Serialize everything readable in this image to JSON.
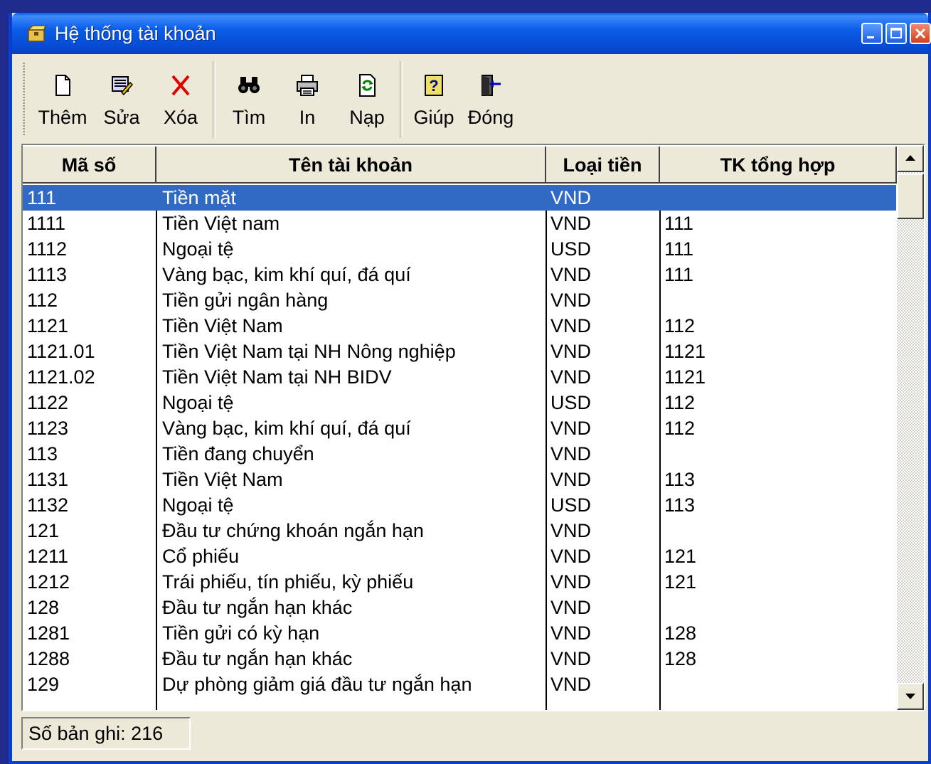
{
  "window": {
    "title": "Hệ thống tài khoản",
    "title_icon": "folder-box-icon"
  },
  "toolbar": {
    "buttons": [
      {
        "label": "Thêm",
        "icon": "new-document-icon"
      },
      {
        "label": "Sửa",
        "icon": "edit-icon"
      },
      {
        "label": "Xóa",
        "icon": "delete-x-icon"
      },
      {
        "label": "Tìm",
        "icon": "binoculars-icon"
      },
      {
        "label": "In",
        "icon": "printer-icon"
      },
      {
        "label": "Nạp",
        "icon": "refresh-icon"
      },
      {
        "label": "Giúp",
        "icon": "help-icon"
      },
      {
        "label": "Đóng",
        "icon": "exit-door-icon"
      }
    ]
  },
  "table": {
    "columns": [
      "Mã số",
      "Tên tài khoản",
      "Loại tiền",
      "TK tổng hợp"
    ],
    "rows": [
      [
        "111",
        "Tiền mặt",
        "VND",
        ""
      ],
      [
        "1111",
        "Tiền Việt nam",
        "VND",
        "111"
      ],
      [
        "1112",
        "Ngoại tệ",
        "USD",
        "111"
      ],
      [
        "1113",
        "Vàng bạc, kim khí quí, đá quí",
        "VND",
        "111"
      ],
      [
        "112",
        "Tiền gửi ngân hàng",
        "VND",
        ""
      ],
      [
        "1121",
        "Tiền Việt Nam",
        "VND",
        "112"
      ],
      [
        "1121.01",
        "Tiền Việt Nam tại NH Nông nghiệp",
        "VND",
        "1121"
      ],
      [
        "1121.02",
        "Tiền Việt Nam tại NH BIDV",
        "VND",
        "1121"
      ],
      [
        "1122",
        "Ngoại tệ",
        "USD",
        "112"
      ],
      [
        "1123",
        "Vàng bạc, kim khí quí, đá quí",
        "VND",
        "112"
      ],
      [
        "113",
        "Tiền đang chuyển",
        "VND",
        ""
      ],
      [
        "1131",
        "Tiền Việt Nam",
        "VND",
        "113"
      ],
      [
        "1132",
        "Ngoại tệ",
        "USD",
        "113"
      ],
      [
        "121",
        "Đầu tư chứng khoán ngắn hạn",
        "VND",
        ""
      ],
      [
        "1211",
        "Cổ phiếu",
        "VND",
        "121"
      ],
      [
        "1212",
        "Trái phiếu, tín phiếu, kỳ phiếu",
        "VND",
        "121"
      ],
      [
        "128",
        "Đầu tư ngắn hạn khác",
        "VND",
        ""
      ],
      [
        "1281",
        "Tiền gửi có kỳ hạn",
        "VND",
        "128"
      ],
      [
        "1288",
        "Đầu tư ngắn hạn khác",
        "VND",
        "128"
      ],
      [
        "129",
        "Dự phòng giảm giá đầu tư ngắn hạn",
        "VND",
        ""
      ]
    ],
    "selected_row": 0
  },
  "status": {
    "record_count": "Số bản ghi: 216"
  },
  "colors": {
    "selection": "#316ac5",
    "titlebar": "#0b5de8",
    "desktop": "#1e2b8c"
  }
}
